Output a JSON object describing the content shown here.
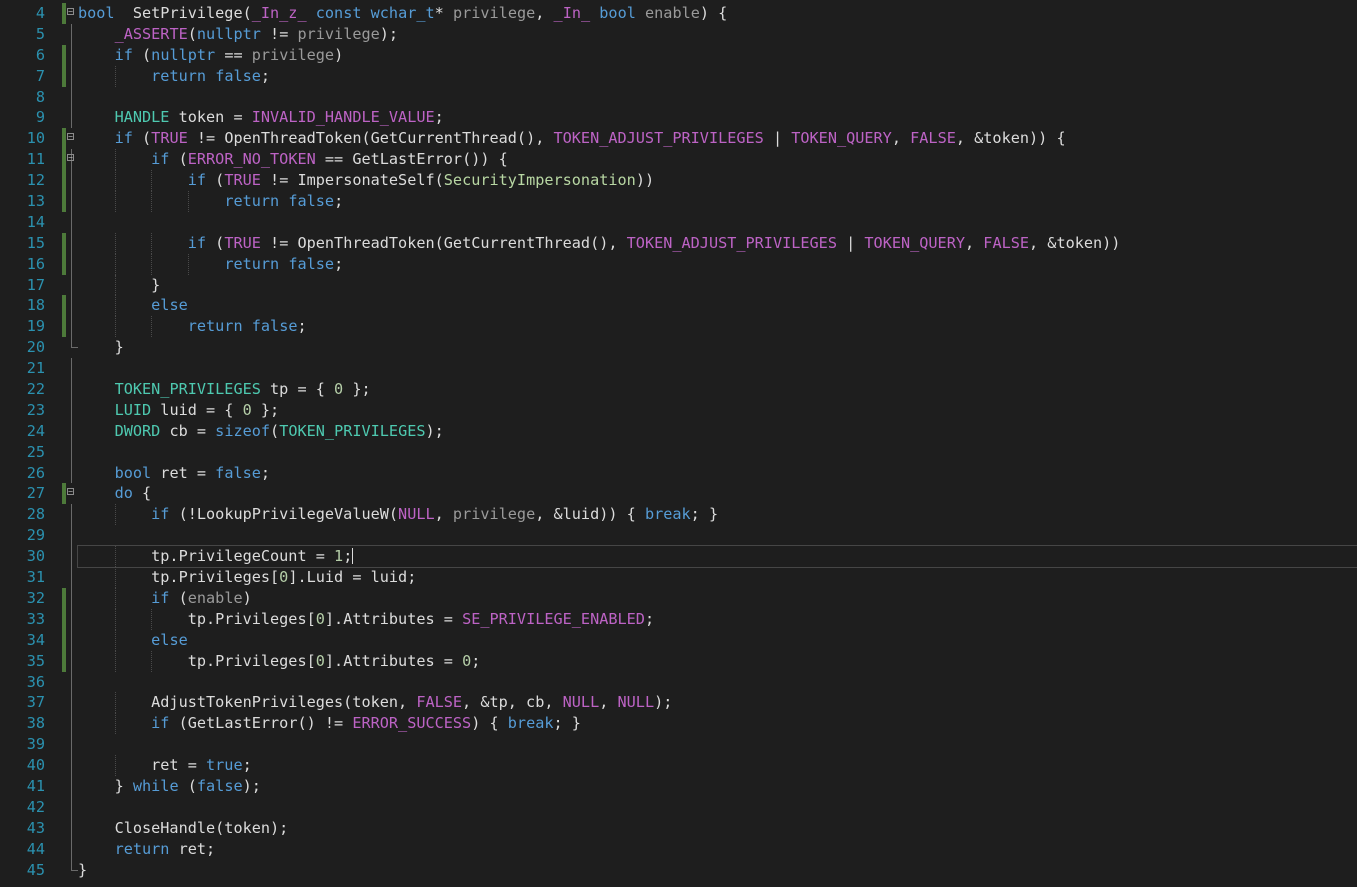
{
  "editor": {
    "colors": {
      "background": "#1e1e1e",
      "line_number": "#2b91af",
      "keyword": "#569cd6",
      "macro": "#bd63c5",
      "type": "#4ec9b0",
      "number": "#b5cea8",
      "parameter": "#9a9a9a",
      "enum": "#b8d7a3",
      "text": "#dcdcdc",
      "change_marker": "#4d7a3a"
    },
    "lines": [
      {
        "num": "4",
        "t": [
          [
            "kw",
            "bool"
          ],
          [
            "",
            "  SetPrivilege("
          ],
          [
            "mac",
            "_In_z_"
          ],
          [
            "",
            " "
          ],
          [
            "kw",
            "const"
          ],
          [
            "",
            " "
          ],
          [
            "kw",
            "wchar_t"
          ],
          [
            "",
            "* "
          ],
          [
            "par",
            "privilege"
          ],
          [
            "",
            ", "
          ],
          [
            "mac",
            "_In_"
          ],
          [
            "",
            " "
          ],
          [
            "kw",
            "bool"
          ],
          [
            "",
            " "
          ],
          [
            "par",
            "enable"
          ],
          [
            "",
            ") {"
          ]
        ]
      },
      {
        "num": "5",
        "t": [
          [
            "",
            "    "
          ],
          [
            "mac",
            "_ASSERTE"
          ],
          [
            "",
            "("
          ],
          [
            "kw",
            "nullptr"
          ],
          [
            "",
            " != "
          ],
          [
            "par",
            "privilege"
          ],
          [
            "",
            ");"
          ]
        ]
      },
      {
        "num": "6",
        "t": [
          [
            "",
            "    "
          ],
          [
            "kw",
            "if"
          ],
          [
            "",
            " ("
          ],
          [
            "kw",
            "nullptr"
          ],
          [
            "",
            " == "
          ],
          [
            "par",
            "privilege"
          ],
          [
            "",
            ")"
          ]
        ]
      },
      {
        "num": "7",
        "t": [
          [
            "",
            "        "
          ],
          [
            "kw",
            "return"
          ],
          [
            "",
            " "
          ],
          [
            "kw",
            "false"
          ],
          [
            "",
            ";"
          ]
        ]
      },
      {
        "num": "8",
        "t": []
      },
      {
        "num": "9",
        "t": [
          [
            "",
            "    "
          ],
          [
            "typ",
            "HANDLE"
          ],
          [
            "",
            " token = "
          ],
          [
            "mac",
            "INVALID_HANDLE_VALUE"
          ],
          [
            "",
            ";"
          ]
        ]
      },
      {
        "num": "10",
        "t": [
          [
            "",
            "    "
          ],
          [
            "kw",
            "if"
          ],
          [
            "",
            " ("
          ],
          [
            "mac",
            "TRUE"
          ],
          [
            "",
            " != OpenThreadToken(GetCurrentThread(), "
          ],
          [
            "mac",
            "TOKEN_ADJUST_PRIVILEGES"
          ],
          [
            "",
            " | "
          ],
          [
            "mac",
            "TOKEN_QUERY"
          ],
          [
            "",
            ", "
          ],
          [
            "mac",
            "FALSE"
          ],
          [
            "",
            ", &token)) {"
          ]
        ]
      },
      {
        "num": "11",
        "t": [
          [
            "",
            "        "
          ],
          [
            "kw",
            "if"
          ],
          [
            "",
            " ("
          ],
          [
            "mac",
            "ERROR_NO_TOKEN"
          ],
          [
            "",
            " == GetLastError()) {"
          ]
        ]
      },
      {
        "num": "12",
        "t": [
          [
            "",
            "            "
          ],
          [
            "kw",
            "if"
          ],
          [
            "",
            " ("
          ],
          [
            "mac",
            "TRUE"
          ],
          [
            "",
            " != ImpersonateSelf("
          ],
          [
            "enum",
            "SecurityImpersonation"
          ],
          [
            "",
            "))"
          ]
        ]
      },
      {
        "num": "13",
        "t": [
          [
            "",
            "                "
          ],
          [
            "kw",
            "return"
          ],
          [
            "",
            " "
          ],
          [
            "kw",
            "false"
          ],
          [
            "",
            ";"
          ]
        ]
      },
      {
        "num": "14",
        "t": []
      },
      {
        "num": "15",
        "t": [
          [
            "",
            "            "
          ],
          [
            "kw",
            "if"
          ],
          [
            "",
            " ("
          ],
          [
            "mac",
            "TRUE"
          ],
          [
            "",
            " != OpenThreadToken(GetCurrentThread(), "
          ],
          [
            "mac",
            "TOKEN_ADJUST_PRIVILEGES"
          ],
          [
            "",
            " | "
          ],
          [
            "mac",
            "TOKEN_QUERY"
          ],
          [
            "",
            ", "
          ],
          [
            "mac",
            "FALSE"
          ],
          [
            "",
            ", &token))"
          ]
        ]
      },
      {
        "num": "16",
        "t": [
          [
            "",
            "                "
          ],
          [
            "kw",
            "return"
          ],
          [
            "",
            " "
          ],
          [
            "kw",
            "false"
          ],
          [
            "",
            ";"
          ]
        ]
      },
      {
        "num": "17",
        "t": [
          [
            "",
            "        }"
          ]
        ]
      },
      {
        "num": "18",
        "t": [
          [
            "",
            "        "
          ],
          [
            "kw",
            "else"
          ]
        ]
      },
      {
        "num": "19",
        "t": [
          [
            "",
            "            "
          ],
          [
            "kw",
            "return"
          ],
          [
            "",
            " "
          ],
          [
            "kw",
            "false"
          ],
          [
            "",
            ";"
          ]
        ]
      },
      {
        "num": "20",
        "t": [
          [
            "",
            "    }"
          ]
        ]
      },
      {
        "num": "21",
        "t": []
      },
      {
        "num": "22",
        "t": [
          [
            "",
            "    "
          ],
          [
            "typ",
            "TOKEN_PRIVILEGES"
          ],
          [
            "",
            " tp = { "
          ],
          [
            "num",
            "0"
          ],
          [
            "",
            " };"
          ]
        ]
      },
      {
        "num": "23",
        "t": [
          [
            "",
            "    "
          ],
          [
            "typ",
            "LUID"
          ],
          [
            "",
            " luid = { "
          ],
          [
            "num",
            "0"
          ],
          [
            "",
            " };"
          ]
        ]
      },
      {
        "num": "24",
        "t": [
          [
            "",
            "    "
          ],
          [
            "typ",
            "DWORD"
          ],
          [
            "",
            " cb = "
          ],
          [
            "kw",
            "sizeof"
          ],
          [
            "",
            "("
          ],
          [
            "typ",
            "TOKEN_PRIVILEGES"
          ],
          [
            "",
            ");"
          ]
        ]
      },
      {
        "num": "25",
        "t": []
      },
      {
        "num": "26",
        "t": [
          [
            "",
            "    "
          ],
          [
            "kw",
            "bool"
          ],
          [
            "",
            " ret = "
          ],
          [
            "kw",
            "false"
          ],
          [
            "",
            ";"
          ]
        ]
      },
      {
        "num": "27",
        "t": [
          [
            "",
            "    "
          ],
          [
            "kw",
            "do"
          ],
          [
            "",
            " {"
          ]
        ]
      },
      {
        "num": "28",
        "t": [
          [
            "",
            "        "
          ],
          [
            "kw",
            "if"
          ],
          [
            "",
            " (!LookupPrivilegeValueW("
          ],
          [
            "mac",
            "NULL"
          ],
          [
            "",
            ", "
          ],
          [
            "par",
            "privilege"
          ],
          [
            "",
            ", &luid)) { "
          ],
          [
            "kw",
            "break"
          ],
          [
            "",
            "; }"
          ]
        ]
      },
      {
        "num": "29",
        "t": []
      },
      {
        "num": "30",
        "t": [
          [
            "",
            "        tp.PrivilegeCount = "
          ],
          [
            "num",
            "1"
          ],
          [
            "",
            ";"
          ]
        ]
      },
      {
        "num": "31",
        "t": [
          [
            "",
            "        tp.Privileges["
          ],
          [
            "num",
            "0"
          ],
          [
            "",
            "].Luid = luid;"
          ]
        ]
      },
      {
        "num": "32",
        "t": [
          [
            "",
            "        "
          ],
          [
            "kw",
            "if"
          ],
          [
            "",
            " ("
          ],
          [
            "par",
            "enable"
          ],
          [
            "",
            ")"
          ]
        ]
      },
      {
        "num": "33",
        "t": [
          [
            "",
            "            tp.Privileges["
          ],
          [
            "num",
            "0"
          ],
          [
            "",
            "].Attributes = "
          ],
          [
            "mac",
            "SE_PRIVILEGE_ENABLED"
          ],
          [
            "",
            ";"
          ]
        ]
      },
      {
        "num": "34",
        "t": [
          [
            "",
            "        "
          ],
          [
            "kw",
            "else"
          ]
        ]
      },
      {
        "num": "35",
        "t": [
          [
            "",
            "            tp.Privileges["
          ],
          [
            "num",
            "0"
          ],
          [
            "",
            "].Attributes = "
          ],
          [
            "num",
            "0"
          ],
          [
            "",
            ";"
          ]
        ]
      },
      {
        "num": "36",
        "t": []
      },
      {
        "num": "37",
        "t": [
          [
            "",
            "        AdjustTokenPrivileges(token, "
          ],
          [
            "mac",
            "FALSE"
          ],
          [
            "",
            ", &tp, cb, "
          ],
          [
            "mac",
            "NULL"
          ],
          [
            "",
            ", "
          ],
          [
            "mac",
            "NULL"
          ],
          [
            "",
            ");"
          ]
        ]
      },
      {
        "num": "38",
        "t": [
          [
            "",
            "        "
          ],
          [
            "kw",
            "if"
          ],
          [
            "",
            " (GetLastError() != "
          ],
          [
            "mac",
            "ERROR_SUCCESS"
          ],
          [
            "",
            ") { "
          ],
          [
            "kw",
            "break"
          ],
          [
            "",
            "; }"
          ]
        ]
      },
      {
        "num": "39",
        "t": []
      },
      {
        "num": "40",
        "t": [
          [
            "",
            "        ret = "
          ],
          [
            "kw",
            "true"
          ],
          [
            "",
            ";"
          ]
        ]
      },
      {
        "num": "41",
        "t": [
          [
            "",
            "    } "
          ],
          [
            "kw",
            "while"
          ],
          [
            "",
            " ("
          ],
          [
            "kw",
            "false"
          ],
          [
            "",
            ");"
          ]
        ]
      },
      {
        "num": "42",
        "t": []
      },
      {
        "num": "43",
        "t": [
          [
            "",
            "    CloseHandle(token);"
          ]
        ]
      },
      {
        "num": "44",
        "t": [
          [
            "",
            "    "
          ],
          [
            "kw",
            "return"
          ],
          [
            "",
            " ret;"
          ]
        ]
      },
      {
        "num": "45",
        "t": [
          [
            "",
            "}"
          ]
        ]
      }
    ]
  }
}
